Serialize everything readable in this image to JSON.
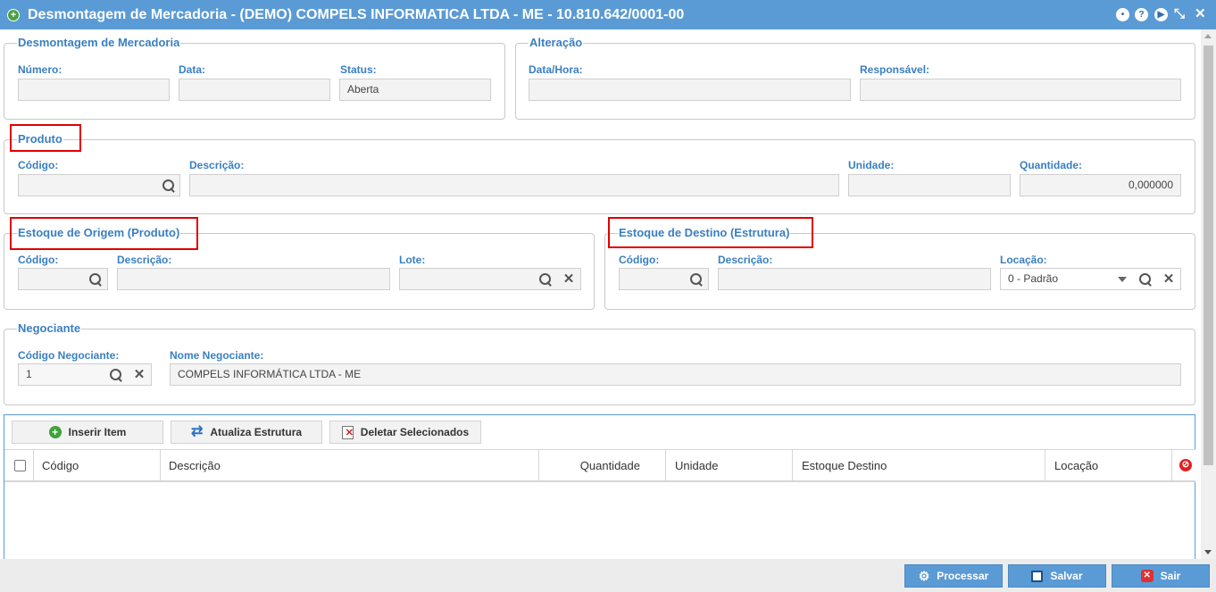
{
  "window": {
    "title": "Desmontagem de Mercadoria - (DEMO) COMPELS INFORMATICA LTDA - ME - 10.810.642/0001-00"
  },
  "desmontagem": {
    "legend": "Desmontagem de Mercadoria",
    "numero_label": "Número:",
    "numero_value": "",
    "data_label": "Data:",
    "data_value": "",
    "status_label": "Status:",
    "status_value": "Aberta"
  },
  "alteracao": {
    "legend": "Alteração",
    "datahora_label": "Data/Hora:",
    "datahora_value": "",
    "responsavel_label": "Responsável:",
    "responsavel_value": ""
  },
  "produto": {
    "legend": "Produto",
    "codigo_label": "Código:",
    "codigo_value": "",
    "descricao_label": "Descrição:",
    "descricao_value": "",
    "unidade_label": "Unidade:",
    "unidade_value": "",
    "quantidade_label": "Quantidade:",
    "quantidade_value": "0,000000"
  },
  "origem": {
    "legend": "Estoque de Origem (Produto)",
    "codigo_label": "Código:",
    "codigo_value": "",
    "descricao_label": "Descrição:",
    "descricao_value": "",
    "lote_label": "Lote:",
    "lote_value": ""
  },
  "destino": {
    "legend": "Estoque de Destino (Estrutura)",
    "codigo_label": "Código:",
    "codigo_value": "",
    "descricao_label": "Descrição:",
    "descricao_value": "",
    "locacao_label": "Locação:",
    "locacao_value": "0 - Padrão"
  },
  "negociante": {
    "legend": "Negociante",
    "codigo_label": "Código Negociante:",
    "codigo_value": "1",
    "nome_label": "Nome Negociante:",
    "nome_value": "COMPELS INFORMÁTICA LTDA - ME"
  },
  "grid": {
    "buttons": {
      "inserir": "Inserir Item",
      "atualiza": "Atualiza Estrutura",
      "deletar": "Deletar Selecionados"
    },
    "columns": [
      "Código",
      "Descrição",
      "Quantidade",
      "Unidade",
      "Estoque Destino",
      "Locação"
    ]
  },
  "footer": {
    "processar": "Processar",
    "salvar": "Salvar",
    "sair": "Sair"
  },
  "colors": {
    "titlebar": "#5b9bd5",
    "label": "#3a7fc1",
    "highlight": "#e00000",
    "button": "#5b9bd5"
  }
}
